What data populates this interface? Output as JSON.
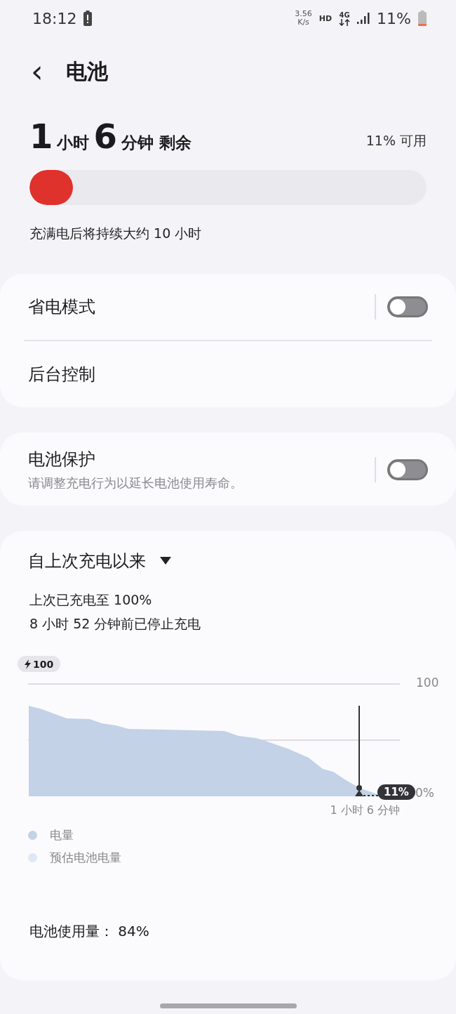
{
  "status_bar": {
    "time": "18:12",
    "speed_value": "3.56",
    "speed_unit": "K/s",
    "hd": "HD",
    "network": "4G",
    "battery": "11%"
  },
  "header": {
    "back": "‹",
    "title": "电池"
  },
  "summary": {
    "remaining": [
      {
        "text": "1",
        "kind": "number"
      },
      {
        "text": "小时",
        "kind": "unit"
      },
      {
        "text": "6",
        "kind": "number"
      },
      {
        "text": "分钟 剩余",
        "kind": "unit"
      }
    ],
    "available": "11% 可用",
    "level": 0.11,
    "caption": "充满电后将持续大约 10 小时"
  },
  "settings_card": [
    {
      "label": "省电模式",
      "kind": "toggle",
      "on": false
    },
    {
      "label": "后台控制",
      "kind": "link"
    }
  ],
  "protection_card": {
    "label": "电池保护",
    "description": "请调整充电行为以延长电池使用寿命。",
    "on": false
  },
  "usage": {
    "period": "自上次充电以来",
    "last_charged": "上次已充电至 100%",
    "stopped": "8 小时 52 分钟前已停止充电",
    "chart": {
      "charge_badge": "100",
      "top_tick": "100",
      "bottom_tick": "0%",
      "current": "11%",
      "remaining": "1 小时 6 分钟"
    },
    "legend": [
      {
        "label": "电量",
        "color": "#c3d2e6"
      },
      {
        "label": "预估电池电量",
        "color": "#dfe8f3"
      }
    ],
    "total": "电池使用量： 84%"
  }
}
